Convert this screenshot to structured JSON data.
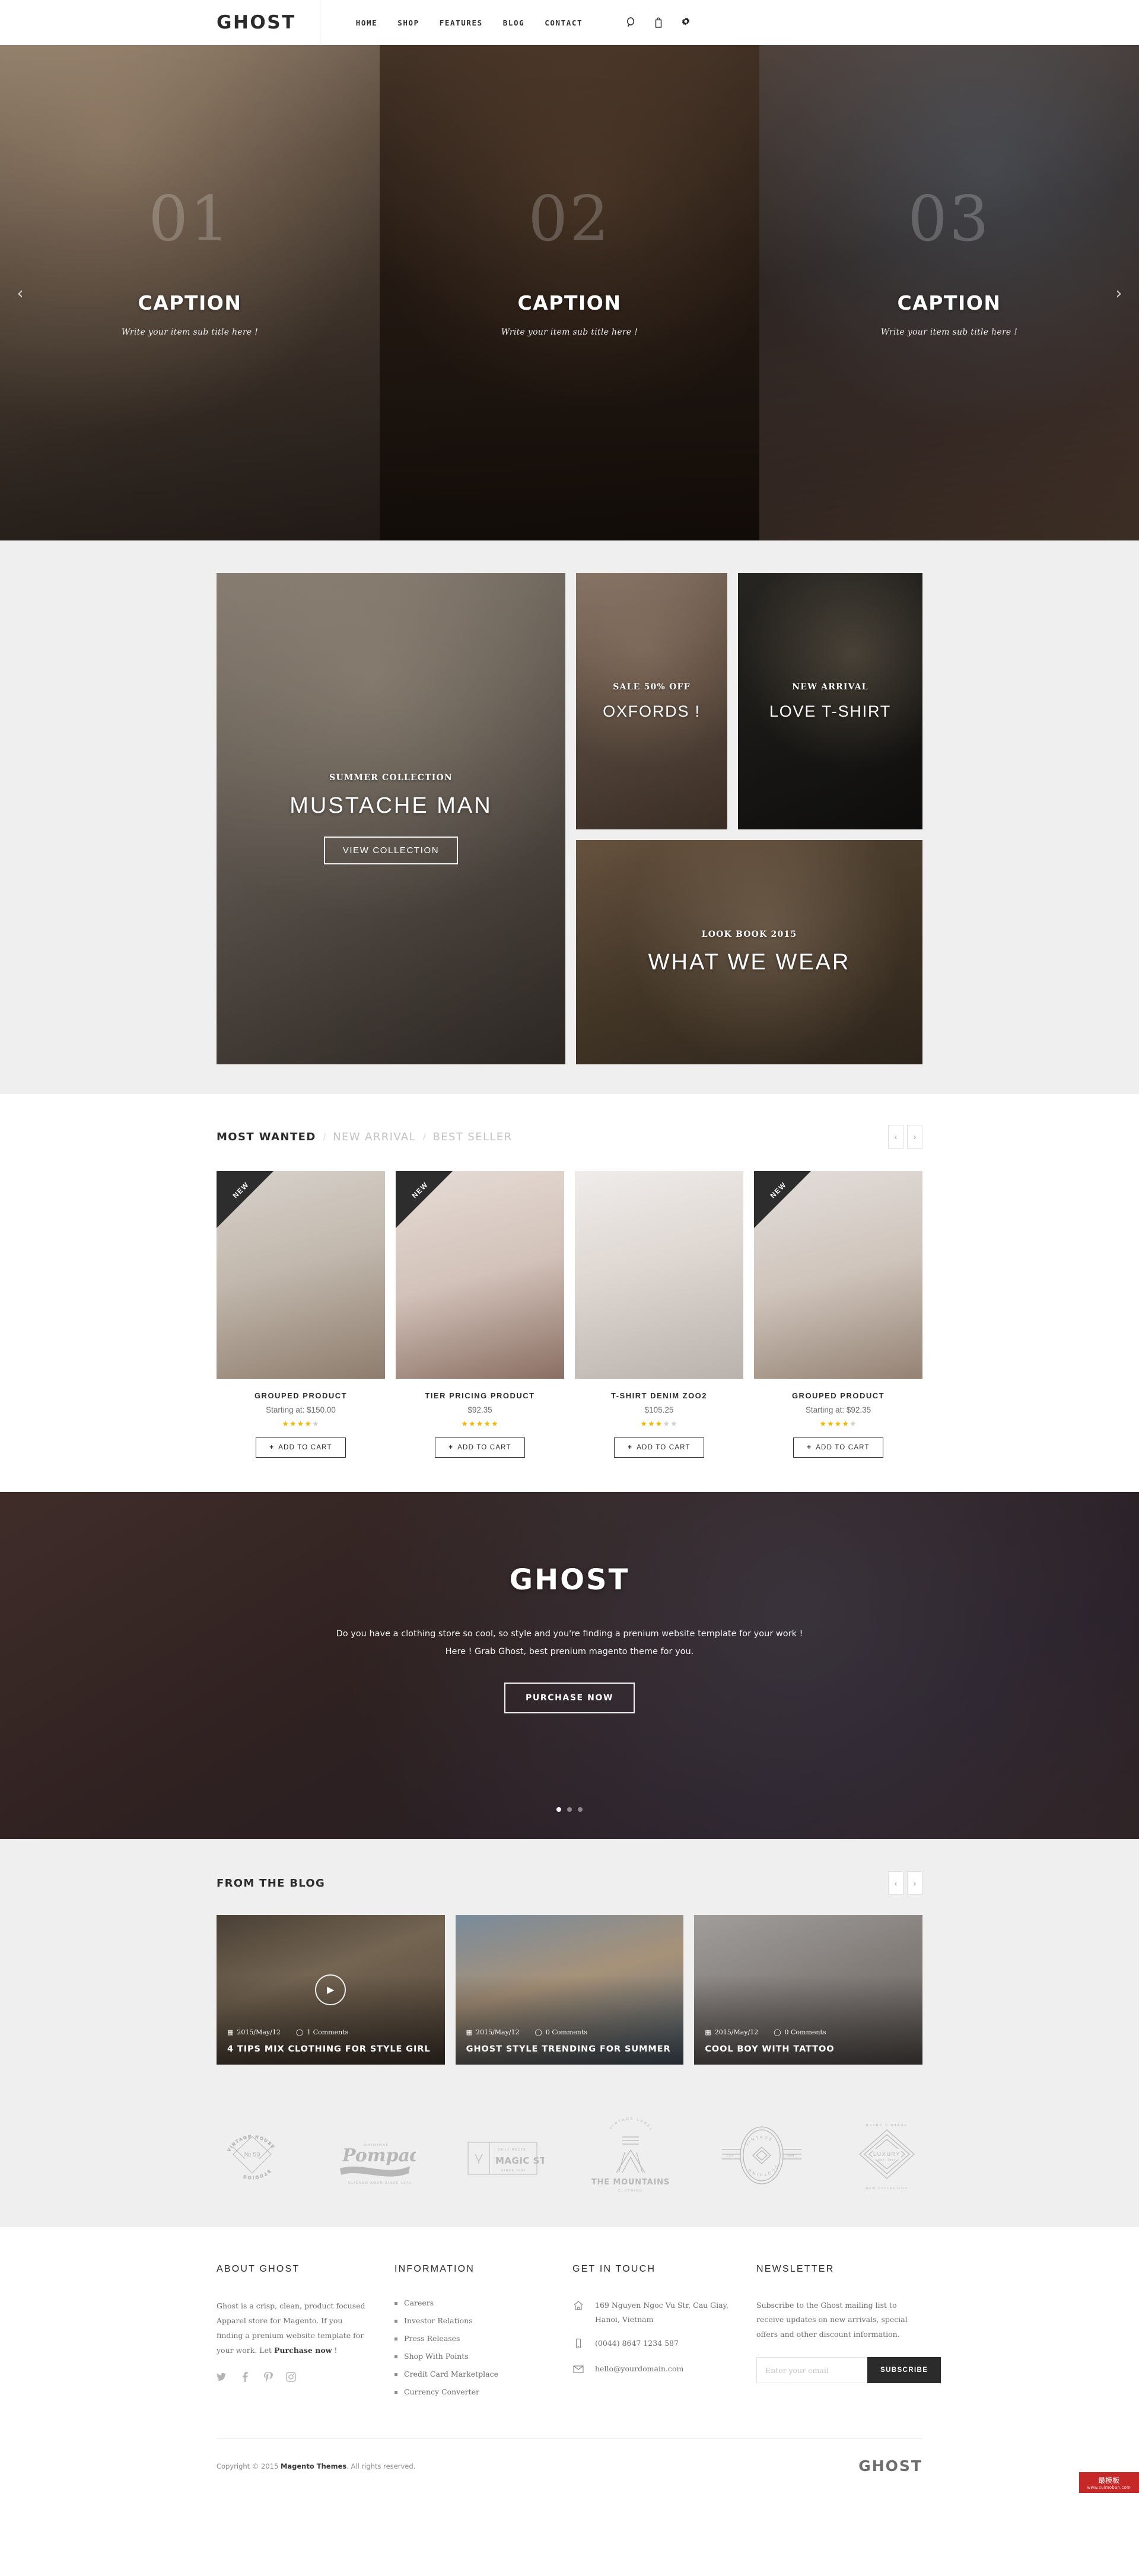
{
  "header": {
    "logo": "GHOST",
    "nav": [
      {
        "label": "HOME"
      },
      {
        "label": "SHOP"
      },
      {
        "label": "FEATURES"
      },
      {
        "label": "BLOG"
      },
      {
        "label": "CONTACT"
      }
    ],
    "icons": [
      {
        "name": "search-icon"
      },
      {
        "name": "cart-icon"
      },
      {
        "name": "settings-icon"
      }
    ]
  },
  "hero": {
    "prev": "‹",
    "next": "›",
    "slides": [
      {
        "number": "01",
        "caption": "CAPTION",
        "subtitle": "Write your item sub title here !"
      },
      {
        "number": "02",
        "caption": "CAPTION",
        "subtitle": "Write your item sub title here !"
      },
      {
        "number": "03",
        "caption": "CAPTION",
        "subtitle": "Write your item sub title here !"
      }
    ]
  },
  "promo": {
    "big": {
      "kicker": "SUMMER COLLECTION",
      "title": "MUSTACHE MAN",
      "button": "VIEW COLLECTION"
    },
    "oxfords": {
      "kicker": "SALE 50% OFF",
      "title": "OXFORDS !"
    },
    "love": {
      "kicker": "NEW ARRIVAL",
      "title": "LOVE T-SHIRT"
    },
    "wear": {
      "kicker": "LOOK BOOK 2015",
      "title": "WHAT WE WEAR"
    }
  },
  "products_section": {
    "tabs": [
      {
        "label": "MOST WANTED",
        "active": true
      },
      {
        "label": "NEW ARRIVAL",
        "active": false
      },
      {
        "label": "BEST SELLER",
        "active": false
      }
    ],
    "separator": "/",
    "prev": "‹",
    "next": "›",
    "add_to_cart_label": "ADD TO CART",
    "plus": "+",
    "items": [
      {
        "badge": "NEW",
        "name": "GROUPED PRODUCT",
        "price": "Starting at: $150.00",
        "rating": 4
      },
      {
        "badge": "NEW",
        "name": "TIER PRICING PRODUCT",
        "price": "$92.35",
        "rating": 5
      },
      {
        "badge": "",
        "name": "T-SHIRT DENIM ZOO2",
        "price": "$105.25",
        "rating": 3
      },
      {
        "badge": "NEW",
        "name": "GROUPED PRODUCT",
        "price": "Starting at: $92.35",
        "rating": 4
      }
    ]
  },
  "banner": {
    "title": "GHOST",
    "line1": "Do you have a clothing store so cool, so style and you're finding a prenium website template for your work !",
    "line2": "Here ! Grab Ghost, best prenium magento theme for you.",
    "button": "PURCHASE NOW",
    "dots": 3,
    "active_dot": 0
  },
  "blog": {
    "title": "FROM THE BLOG",
    "prev": "‹",
    "next": "›",
    "posts": [
      {
        "date": "2015/May/12",
        "comments": "1 Comments",
        "title": "4 TIPS MIX CLOTHING FOR STYLE GIRL",
        "has_play": true
      },
      {
        "date": "2015/May/12",
        "comments": "0 Comments",
        "title": "GHOST STYLE TRENDING FOR SUMMER",
        "has_play": false
      },
      {
        "date": "2015/May/12",
        "comments": "0 Comments",
        "title": "COOL BOY WITH TATTOO",
        "has_play": false
      }
    ]
  },
  "brands": [
    {
      "name": "vintage-house-studio-logo",
      "top": "VINTAGE HOUSE",
      "mid": "Nº 50",
      "bottom": "STUDIOS"
    },
    {
      "name": "pompadour-logo",
      "top": "ORIGINAL",
      "mid": "Pompadour",
      "bottom": "CLIENDO AMOR SINCE 1970"
    },
    {
      "name": "magic-stone-logo",
      "top": "DAILY ROUTE",
      "mid": "MAGIC STONE",
      "bottom": "SINCE 1982"
    },
    {
      "name": "the-mountains-logo",
      "top": "VINTAGE LABEL",
      "mid": "THE MOUNTAINS",
      "bottom": "CLOTHING"
    },
    {
      "name": "vintage-clothing-logo",
      "top": "EST.",
      "mid": "VINTAGE",
      "bottom": "CLOTHING 1984"
    },
    {
      "name": "luxury-retro-logo",
      "top": "RETRO VINTAGE",
      "mid": "LUXURY",
      "bottom": "NEW COLLECTION"
    }
  ],
  "footer": {
    "about": {
      "heading": "ABOUT GHOST",
      "text": "Ghost is a crisp, clean, product focused Apparel store for Magento. If you finding a prenium website template for your work. Let ",
      "link": "Purchase now",
      "tail": " !",
      "social": [
        {
          "name": "twitter-icon"
        },
        {
          "name": "facebook-icon"
        },
        {
          "name": "pinterest-icon"
        },
        {
          "name": "instagram-icon"
        }
      ]
    },
    "information": {
      "heading": "INFORMATION",
      "links": [
        "Careers",
        "Investor Relations",
        "Press Releases",
        "Shop With Points",
        "Credit Card Marketplace",
        "Currency Converter"
      ]
    },
    "contact": {
      "heading": "GET IN TOUCH",
      "address": "169 Nguyen Ngoc Vu Str, Cau Giay, Hanoi, Vietnam",
      "phone": "(0044) 8647 1234 587",
      "email": "hello@yourdomain.com"
    },
    "newsletter": {
      "heading": "NEWSLETTER",
      "text": "Subscribe to the Ghost mailing list to receive updates on new arrivals, special offers and other discount information.",
      "placeholder": "Enter your email",
      "value": "",
      "button": "SUBSCRIBE"
    },
    "bottom": {
      "copyright_pre": "Copyright © 2015 ",
      "copyright_brand": "Magento Themes",
      "copyright_post": ". All rights reserved.",
      "logo": "GHOST"
    }
  },
  "watermark": {
    "main": "最模板",
    "sub": "www.zuimoban.com"
  },
  "colors": {
    "accent": "#2b2b2b",
    "star": "#f2b705",
    "muted": "#c3c3c3",
    "panel": "#efefef"
  }
}
